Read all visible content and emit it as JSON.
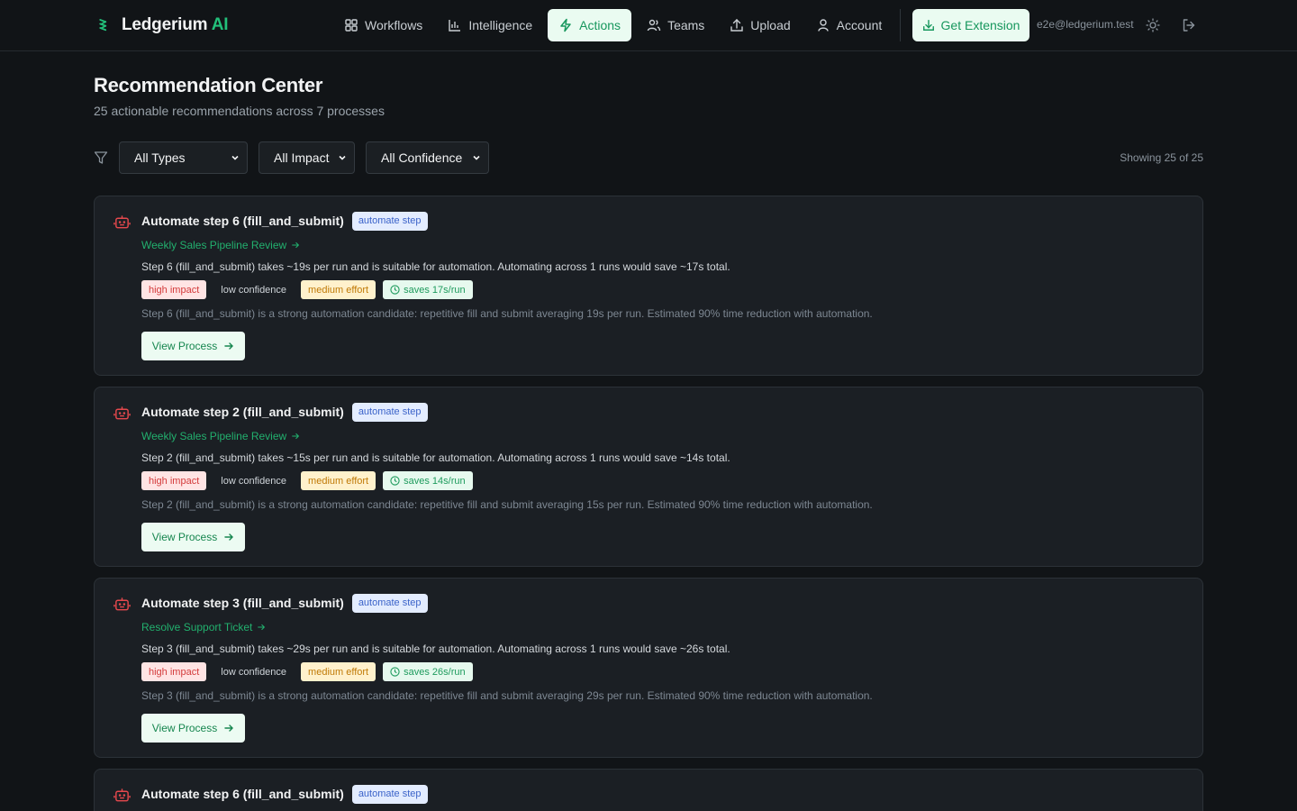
{
  "brand": {
    "name": "Ledgerium",
    "suffix": "AI",
    "accent": "#22c07a"
  },
  "nav": [
    {
      "label": "Workflows",
      "icon": "grid-icon"
    },
    {
      "label": "Intelligence",
      "icon": "bar-chart-icon"
    },
    {
      "label": "Actions",
      "icon": "lightning-icon",
      "active": true
    },
    {
      "label": "Teams",
      "icon": "users-icon"
    },
    {
      "label": "Upload",
      "icon": "upload-icon"
    },
    {
      "label": "Account",
      "icon": "user-icon"
    }
  ],
  "header": {
    "extension_label": "Get Extension",
    "user_email": "e2e@ledgerium.test"
  },
  "page": {
    "title": "Recommendation Center",
    "subtitle": "25 actionable recommendations across 7 processes"
  },
  "filters": {
    "type": "All Types",
    "impact": "All Impact",
    "confidence": "All Confidence",
    "showing": "Showing 25 of 25"
  },
  "cards": [
    {
      "title": "Automate step 6 (fill_and_submit)",
      "type_badge": "automate step",
      "process": "Weekly Sales Pipeline Review",
      "description": "Step 6 (fill_and_submit) takes ~19s per run and is suitable for automation. Automating across 1 runs would save ~17s total.",
      "impact": "high impact",
      "confidence": "low confidence",
      "effort": "medium effort",
      "saves": "saves 17s/run",
      "rationale": "Step 6 (fill_and_submit) is a strong automation candidate: repetitive fill and submit averaging 19s per run. Estimated 90% time reduction with automation.",
      "button": "View Process"
    },
    {
      "title": "Automate step 2 (fill_and_submit)",
      "type_badge": "automate step",
      "process": "Weekly Sales Pipeline Review",
      "description": "Step 2 (fill_and_submit) takes ~15s per run and is suitable for automation. Automating across 1 runs would save ~14s total.",
      "impact": "high impact",
      "confidence": "low confidence",
      "effort": "medium effort",
      "saves": "saves 14s/run",
      "rationale": "Step 2 (fill_and_submit) is a strong automation candidate: repetitive fill and submit averaging 15s per run. Estimated 90% time reduction with automation.",
      "button": "View Process"
    },
    {
      "title": "Automate step 3 (fill_and_submit)",
      "type_badge": "automate step",
      "process": "Resolve Support Ticket",
      "description": "Step 3 (fill_and_submit) takes ~29s per run and is suitable for automation. Automating across 1 runs would save ~26s total.",
      "impact": "high impact",
      "confidence": "low confidence",
      "effort": "medium effort",
      "saves": "saves 26s/run",
      "rationale": "Step 3 (fill_and_submit) is a strong automation candidate: repetitive fill and submit averaging 29s per run. Estimated 90% time reduction with automation.",
      "button": "View Process"
    },
    {
      "title": "Automate step 6 (fill_and_submit)",
      "type_badge": "automate step"
    }
  ]
}
